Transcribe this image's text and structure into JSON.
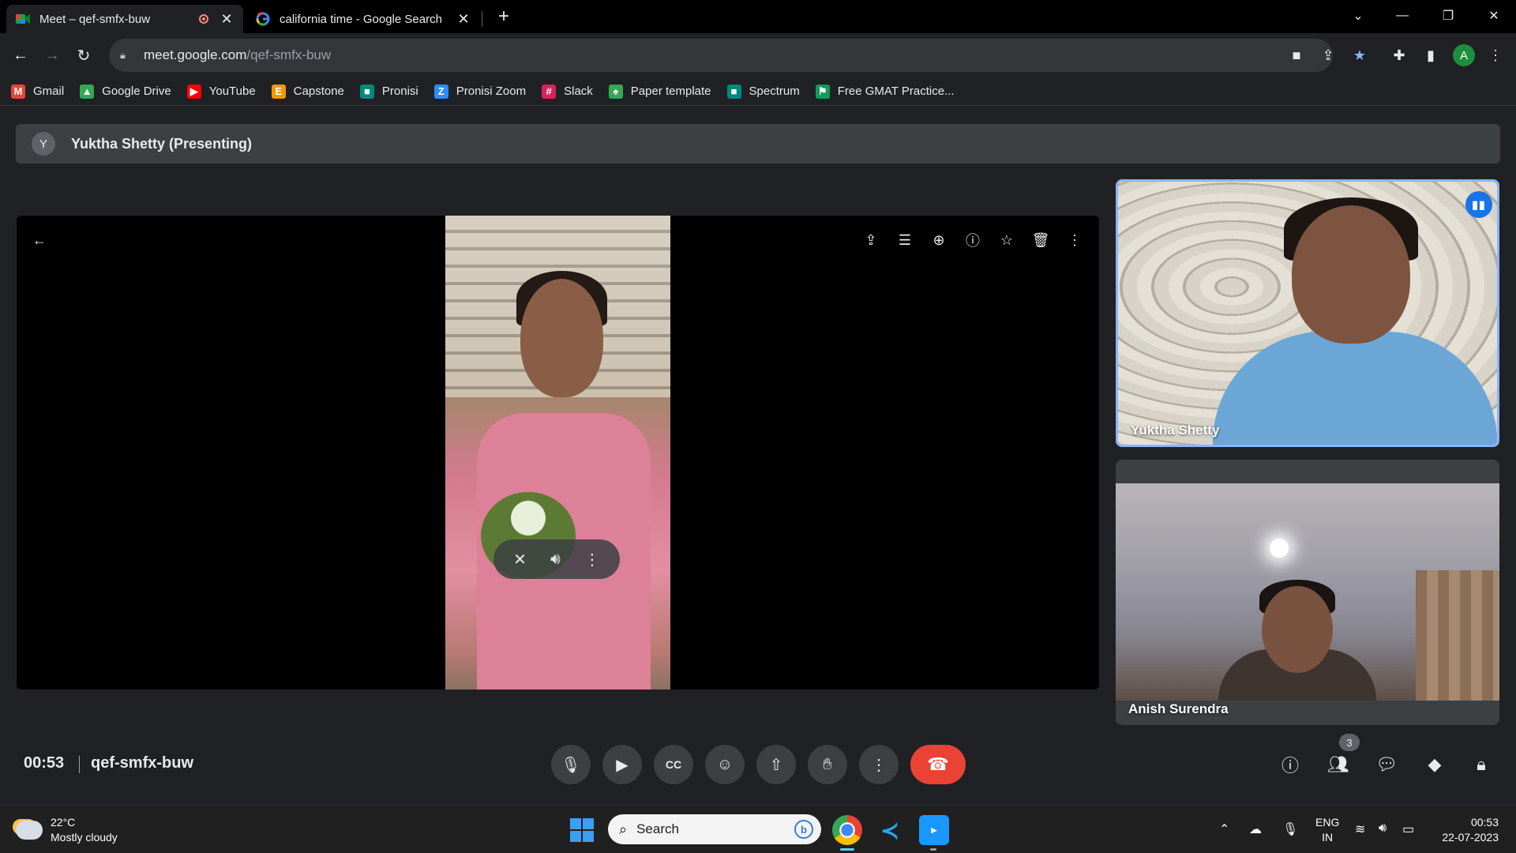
{
  "browser": {
    "tabs": [
      {
        "title": "Meet – qef-smfx-buw",
        "active": true,
        "recording": true
      },
      {
        "title": "california time - Google Search",
        "active": false
      }
    ],
    "url_host": "meet.google.com",
    "url_path": "/qef-smfx-buw",
    "profile_initial": "A",
    "bookmarks": [
      {
        "label": "Gmail",
        "icon": "gmail-icon",
        "color": "#ea4335"
      },
      {
        "label": "Google Drive",
        "icon": "drive-icon",
        "color": "#34a853"
      },
      {
        "label": "YouTube",
        "icon": "youtube-icon",
        "color": "#ff0000"
      },
      {
        "label": "Capstone",
        "icon": "capstone-icon",
        "color": "#f29900"
      },
      {
        "label": "Pronisi",
        "icon": "meet-icon",
        "color": "#00897b"
      },
      {
        "label": "Pronisi Zoom",
        "icon": "zoom-icon",
        "color": "#2d8cff"
      },
      {
        "label": "Slack",
        "icon": "slack-icon",
        "color": "#e01e5a"
      },
      {
        "label": "Paper template",
        "icon": "leaf-icon",
        "color": "#34a853"
      },
      {
        "label": "Spectrum",
        "icon": "meet-icon",
        "color": "#00897b"
      },
      {
        "label": "Free GMAT Practice...",
        "icon": "gmat-icon",
        "color": "#0f9d58"
      }
    ]
  },
  "meet": {
    "presenter_initial": "Y",
    "presenter_banner": "Yuktha Shetty (Presenting)",
    "participants": [
      {
        "name": "Yuktha Shetty",
        "speaking": true
      },
      {
        "name": "Anish Surendra",
        "speaking": false
      }
    ],
    "meeting_time": "00:53",
    "meeting_code": "qef-smfx-buw",
    "people_count": "3",
    "accent_color": "#8ab4f8",
    "hangup_color": "#ea4335"
  },
  "taskbar": {
    "weather_temp": "22°C",
    "weather_desc": "Mostly cloudy",
    "search_placeholder": "Search",
    "lang_line1": "ENG",
    "lang_line2": "IN",
    "clock_time": "00:53",
    "clock_date": "22-07-2023"
  }
}
